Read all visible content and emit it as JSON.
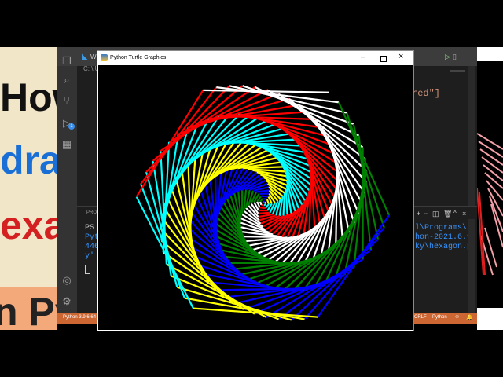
{
  "thumbnail": {
    "words": [
      {
        "text": "How",
        "color": "#111111"
      },
      {
        "text": "dra",
        "color": "#1a6fd6"
      },
      {
        "text": "exa",
        "color": "#d42020"
      },
      {
        "text": "n Py",
        "color": "#222222"
      }
    ]
  },
  "vscode": {
    "title_fragment": "Wi",
    "path_fragment": "C: \\ U",
    "editor_snippet": "red\"]",
    "terminal_tab": "PROB",
    "terminal_left_lines": [
      "PS",
      "Pyt",
      "446",
      "y'"
    ],
    "terminal_right_lines": [
      "al\\Programs\\",
      "thon-2021.6.9",
      "sky\\hexagon.p"
    ],
    "status_left": "Python 3.9.6 64",
    "status_right": [
      "CRLF",
      "Python"
    ],
    "notification_badge": "1"
  },
  "turtle_window": {
    "title": "Python Turtle Graphics",
    "controls": [
      "minimize",
      "maximize",
      "close"
    ]
  },
  "colors": {
    "spiral": [
      "red",
      "white",
      "green",
      "blue",
      "yellow",
      "cyan"
    ],
    "status_bar": "#cc6633"
  }
}
